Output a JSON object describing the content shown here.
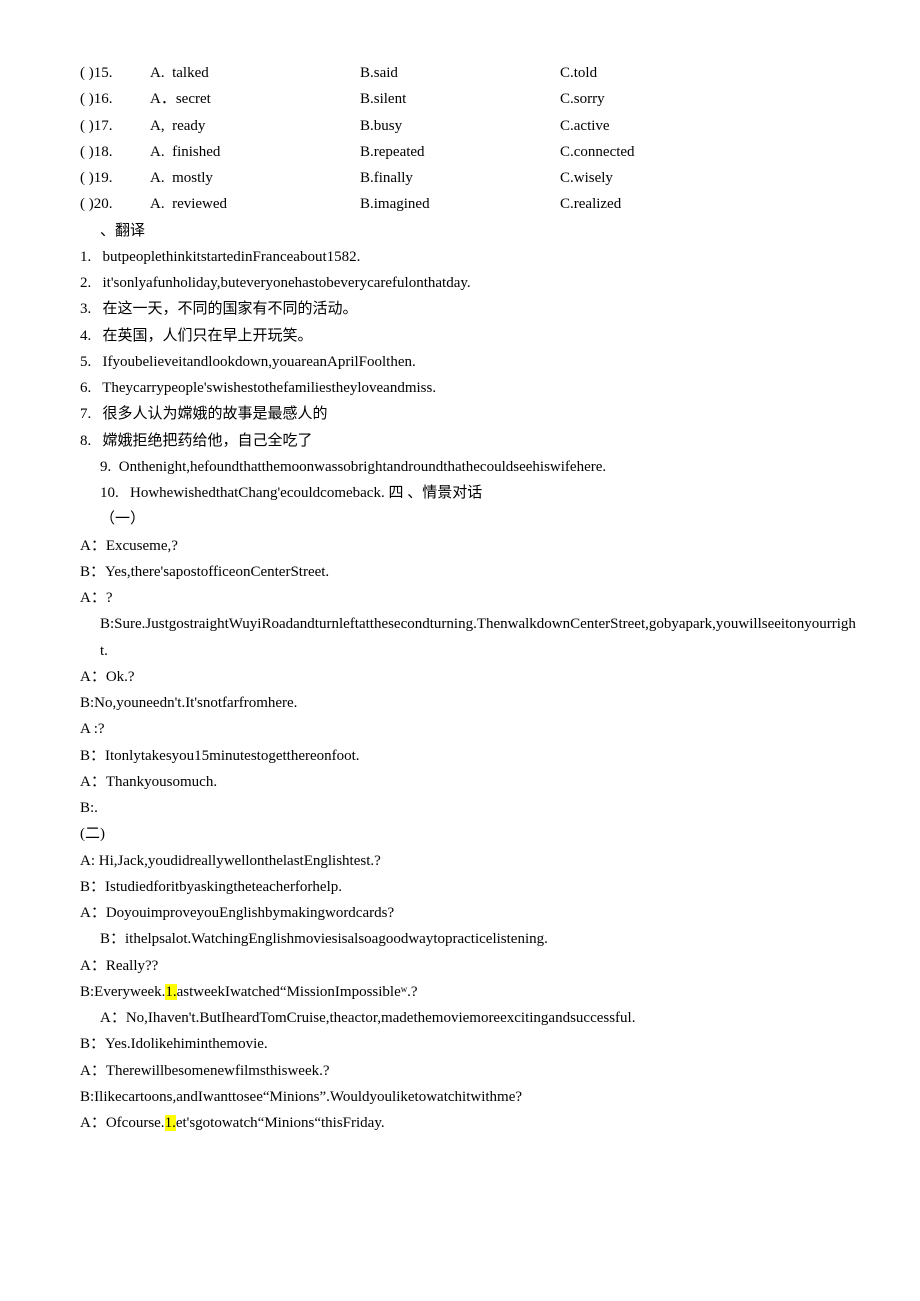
{
  "mc": [
    {
      "num": "( )15.",
      "a": "A.  talked",
      "b": "B.said",
      "c": "C.told"
    },
    {
      "num": "( )16.",
      "a": "A．secret",
      "b": "B.silent",
      "c": "C.sorry"
    },
    {
      "num": "( )17.",
      "a": "A,  ready",
      "b": "B.busy",
      "c": "C.active"
    },
    {
      "num": "( )18.",
      "a": "A.  finished",
      "b": "B.repeated",
      "c": "C.connected"
    },
    {
      "num": "( )19.",
      "a": "A.  mostly",
      "b": "B.finally",
      "c": "C.wisely"
    },
    {
      "num": "( )20.",
      "a": "A.  reviewed",
      "b": "B.imagined",
      "c": "C.realized"
    }
  ],
  "transHeader": "、翻译",
  "trans": [
    "1.   butpeoplethinkitstartedinFranceabout1582.",
    "2.   it'sonlyafunholiday,buteveryonehastobeverycarefulonthatday.",
    "3.   在这一天，不同的国家有不同的活动。",
    "4.   在英国，人们只在早上开玩笑。",
    "5.   Ifyoubelieveitandlookdown,youareanAprilFoolthen.",
    "6.   Theycarrypeople'swishestothefamiliestheyloveandmiss.",
    "7.   很多人认为嫦娥的故事是最感人的",
    "8.   嫦娥拒绝把药给他，自己全吃了"
  ],
  "trans9": "9.  Onthenight,hefoundthatthemoonwassobrightandroundthathecouldseehiswifehere.",
  "trans10": "10.   HowhewishedthatChang'ecouldcomeback. 四 、情景对话",
  "dlg1h": "（一）",
  "dlg1": [
    "A：Excuseme,?",
    "B：Yes,there'sapostofficeonCenterStreet.",
    "A：?"
  ],
  "dlg1b": "B:Sure.JustgostraightWuyiRoadandturnleftatthesecondturning.ThenwalkdownCenterStreet,gobyapark,youwillseeitonyourright.",
  "dlg1c": [
    "A：Ok.?",
    "B:No,youneedn't.It'snotfarfromhere.",
    "A :?",
    "B：Itonlytakesyou15minutestogetthereonfoot.",
    "A：Thankyousomuch.",
    "B:."
  ],
  "dlg2h": "(二)",
  "dlg2": [
    "A: Hi,Jack,youdidreallywellonthelastEnglishtest.?",
    "B：Istudiedforitbyaskingtheteacherforhelp.",
    "A：DoyouimproveyouEnglishbymakingwordcards?"
  ],
  "dlg2b": "B：ithelpsalot.WatchingEnglishmoviesisalsoagoodwaytopracticelistening.",
  "dlg2c": "A：Really??",
  "dlg2d_pre": "B:Everyweek.",
  "dlg2d_hl": "1.",
  "dlg2d_post": "astweekIwatched“MissionImpossibleʷ.?",
  "dlg2e": "A：No,Ihaven't.ButIheardTomCruise,theactor,madethemoviemoreexcitingandsuccessful.",
  "dlg2f": [
    "B：Yes.Idolikehiminthemovie.",
    "A：Therewillbesomenewfilmsthisweek.?",
    "B:Ilikecartoons,andIwanttosee“Minions”.Wouldyouliketowatchitwithme?"
  ],
  "dlg2g_pre": "A：Ofcourse.",
  "dlg2g_hl": "1.",
  "dlg2g_post": "et'sgotowatch“Minions“thisFriday."
}
